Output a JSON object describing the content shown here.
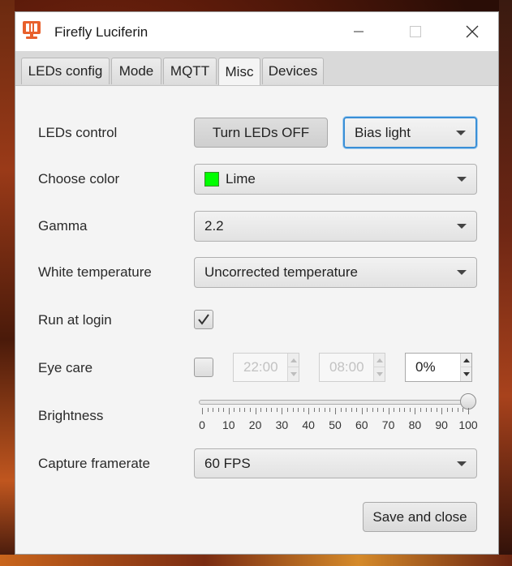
{
  "window": {
    "title": "Firefly Luciferin"
  },
  "tabs": [
    {
      "label": "LEDs config"
    },
    {
      "label": "Mode"
    },
    {
      "label": "MQTT"
    },
    {
      "label": "Misc"
    },
    {
      "label": "Devices"
    }
  ],
  "active_tab": "Misc",
  "form": {
    "leds_control": {
      "label": "LEDs control",
      "button": "Turn LEDs OFF",
      "mode": "Bias light"
    },
    "choose_color": {
      "label": "Choose color",
      "value": "Lime",
      "swatch": "#00ff00"
    },
    "gamma": {
      "label": "Gamma",
      "value": "2.2"
    },
    "white_temperature": {
      "label": "White temperature",
      "value": "Uncorrected temperature"
    },
    "run_at_login": {
      "label": "Run at login",
      "checked": true
    },
    "eye_care": {
      "label": "Eye care",
      "checked": false,
      "start": "22:00",
      "end": "08:00",
      "percent": "0%"
    },
    "brightness": {
      "label": "Brightness",
      "value": 100,
      "min": 0,
      "max": 100,
      "tick_labels": [
        "0",
        "10",
        "20",
        "30",
        "40",
        "50",
        "60",
        "70",
        "80",
        "90",
        "100"
      ]
    },
    "capture_framerate": {
      "label": "Capture framerate",
      "value": "60 FPS"
    }
  },
  "footer": {
    "save_label": "Save and close"
  },
  "colors": {
    "accent_focus": "#3a8fd6",
    "brand_orange": "#e8602c"
  }
}
